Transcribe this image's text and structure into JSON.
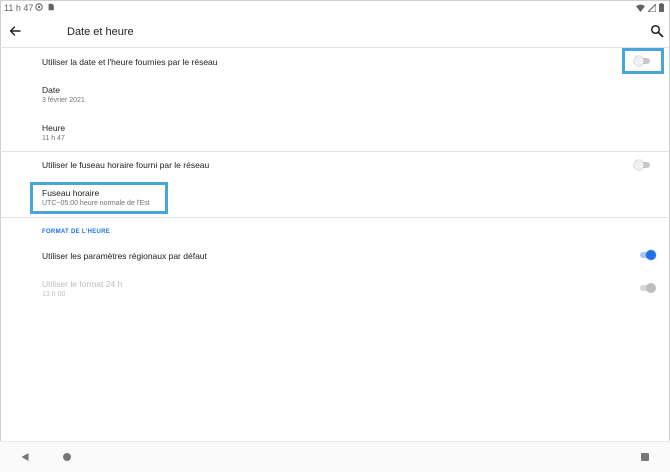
{
  "status_bar": {
    "time": "11 h 47",
    "icons": [
      "settings-status-icon",
      "sim-card-icon"
    ],
    "right_icons": [
      "wifi-icon",
      "signal-icon",
      "battery-icon"
    ]
  },
  "header": {
    "title": "Date et heure",
    "back_icon": "arrow-left-icon",
    "search_icon": "search-icon"
  },
  "settings": {
    "network_time": {
      "title": "Utiliser la date et l'heure fournies par le réseau",
      "toggle_on": false
    },
    "date": {
      "title": "Date",
      "value": "3 février 2021"
    },
    "time": {
      "title": "Heure",
      "value": "11 h 47"
    },
    "network_timezone": {
      "title": "Utiliser le fuseau horaire fourni par le réseau",
      "toggle_on": false
    },
    "timezone": {
      "title": "Fuseau horaire",
      "value": "UTC−05:00 heure normale de l'Est"
    }
  },
  "time_format": {
    "section_title": "FORMAT DE L'HEURE",
    "locale_default": {
      "title": "Utiliser les paramètres régionaux par défaut",
      "toggle_on": true
    },
    "use_24h": {
      "title": "Utiliser le format 24 h",
      "value": "13 h 00",
      "toggle_on": true,
      "enabled": false
    }
  },
  "nav_bar": {
    "icons": [
      "nav-back-icon",
      "nav-home-icon",
      "nav-recents-icon"
    ]
  },
  "colors": {
    "accent": "#1a73e8",
    "highlight": "#4aa3d9",
    "divider": "#e3e3e3"
  }
}
